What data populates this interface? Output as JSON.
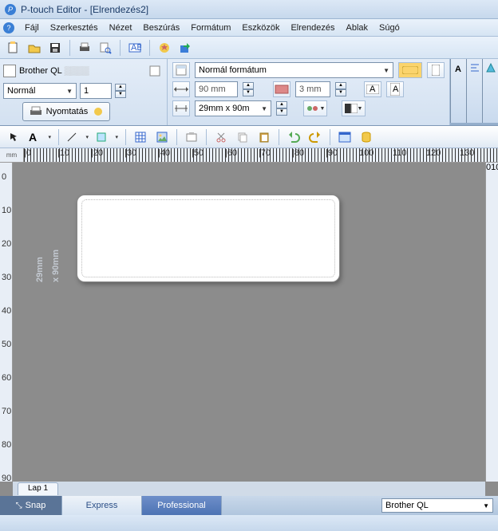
{
  "title": "P-touch Editor - [Elrendezés2]",
  "menu": [
    "Fájl",
    "Szerkesztés",
    "Nézet",
    "Beszúrás",
    "Formátum",
    "Eszközök",
    "Elrendezés",
    "Ablak",
    "Súgó"
  ],
  "printer": {
    "name": "Brother QL",
    "model_blur": "▒▒▒▒"
  },
  "left_dock": {
    "zoom_combo": "Normál",
    "copies": "1",
    "print_label": "Nyomtatás"
  },
  "mid_dock": {
    "format_combo": "Normál formátum",
    "width": "90 mm",
    "margin": "3 mm",
    "media_combo": "29mm x 90m"
  },
  "ruler_unit": "mm",
  "ruler_h": [
    "|0",
    "|10",
    "|20",
    "|30",
    "|40",
    "|50",
    "|60",
    "|70",
    "|80",
    "|90",
    "100",
    "110",
    "120",
    "130"
  ],
  "ruler_v": [
    "0",
    "10",
    "20",
    "30",
    "40",
    "50",
    "60",
    "70",
    "80",
    "90"
  ],
  "label_size": {
    "h": "29mm",
    "w": "x 90mm"
  },
  "sheet_tab": "Lap 1",
  "modes": {
    "snap": "Snap",
    "express": "Express",
    "pro": "Professional"
  },
  "status_printer": "Brother QL"
}
